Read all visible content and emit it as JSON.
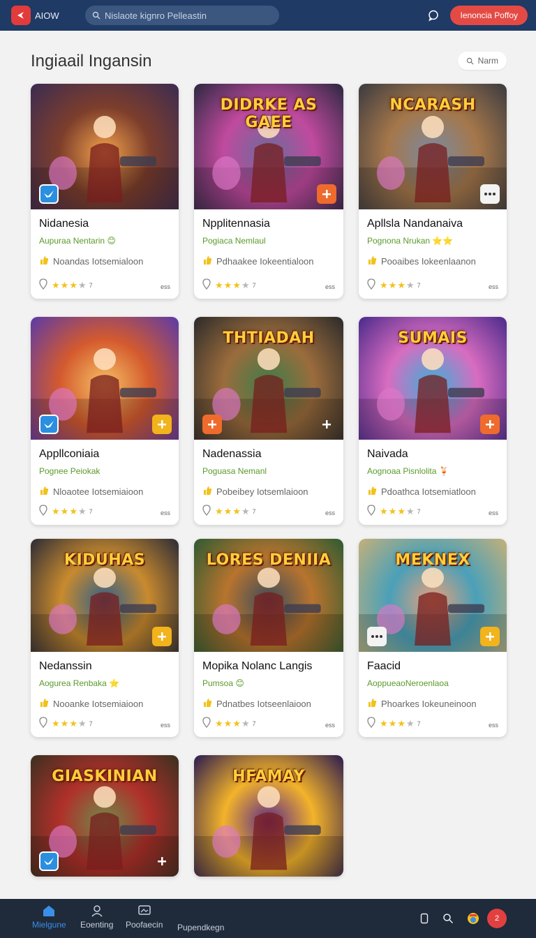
{
  "header": {
    "logo_text": "AIOW",
    "search_placeholder": "Nislaote kignro Pelleastin",
    "cta_label": "Ienoncia Poffoy"
  },
  "page": {
    "title": "Ingiaail Ingansin",
    "sort_label": "Narm"
  },
  "cards": [
    {
      "name": "Nidanesia",
      "sub": "Aupuraa Nentarin",
      "sub_emoji": "😊",
      "desc": "Noandas Iotsemialoon",
      "stars": 3,
      "rating_count": "7",
      "meta": "ess",
      "art_title": "",
      "colors": [
        "#f2a24a",
        "#7d3e2c",
        "#3b2b52"
      ],
      "badge_left": "blue",
      "badge_right": ""
    },
    {
      "name": "Npplitennasia",
      "sub": "Pogiaca Nemlaul",
      "sub_emoji": "",
      "desc": "Pdhaakee Iokeentialoon",
      "stars": 3,
      "rating_count": "7",
      "meta": "ess",
      "art_title": "DIDRKE AS GAEE",
      "colors": [
        "#6a6c9a",
        "#c04a9e",
        "#2b2840"
      ],
      "badge_left": "",
      "badge_right": "orange"
    },
    {
      "name": "Apllsla Nandanaiva",
      "sub": "Pognona Nrukan",
      "sub_emoji": "⭐⭐",
      "desc": "Pooaibes Iokeenlaanon",
      "stars": 3,
      "rating_count": "7",
      "meta": "ess",
      "art_title": "NCARASH",
      "colors": [
        "#7b8aa0",
        "#a5774a",
        "#3a3a40"
      ],
      "badge_left": "",
      "badge_right": "white"
    },
    {
      "name": "Appllconiaia",
      "sub": "Pognee Peiokak",
      "sub_emoji": "",
      "desc": "Nloaotee Iotsemiaioon",
      "stars": 3,
      "rating_count": "7",
      "meta": "ess",
      "art_title": "",
      "colors": [
        "#f5c064",
        "#d45a2e",
        "#5a3aa8"
      ],
      "badge_left": "blue",
      "badge_right": "yellow"
    },
    {
      "name": "Nadenassia",
      "sub": "Poguasa Nemanl",
      "sub_emoji": "",
      "desc": "Pobeibey Iotsemlaioon",
      "stars": 3,
      "rating_count": "7",
      "meta": "ess",
      "art_title": "THTIADAH",
      "colors": [
        "#3e7c4a",
        "#9b6c3c",
        "#2a2a2a"
      ],
      "badge_left": "orange",
      "badge_right": "clear"
    },
    {
      "name": "Naivada",
      "sub": "Aognoaa Pisnlolita",
      "sub_emoji": "🍹",
      "desc": "Pdoathca Iotsemiatloon",
      "stars": 3,
      "rating_count": "7",
      "meta": "ess",
      "art_title": "SUMAIS",
      "colors": [
        "#3ab0d8",
        "#d86cc0",
        "#4a2a8a"
      ],
      "badge_left": "",
      "badge_right": "orange"
    },
    {
      "name": "Nedanssin",
      "sub": "Aogurea Renbaka",
      "sub_emoji": "⭐",
      "desc": "Nooanke Iotsemiaioon",
      "stars": 3,
      "rating_count": "7",
      "meta": "ess",
      "art_title": "KIDUHAS",
      "colors": [
        "#2f5f8a",
        "#c98a2e",
        "#2b2b36"
      ],
      "badge_left": "",
      "badge_right": "yellow"
    },
    {
      "name": "Mopika Nolanc Langis",
      "sub": "Pumsoa",
      "sub_emoji": "😊",
      "desc": "Pdnatbes Iotseenlaioon",
      "stars": 3,
      "rating_count": "7",
      "meta": "ess",
      "art_title": "LORES DENIIA",
      "colors": [
        "#3b4b5c",
        "#b8742e",
        "#2d5a32"
      ],
      "badge_left": "",
      "badge_right": ""
    },
    {
      "name": "Faacid",
      "sub": "AoppueaoNeroenlaoa",
      "sub_emoji": "",
      "desc": "Phoarkes Iokeuneinoon",
      "stars": 3,
      "rating_count": "7",
      "meta": "ess",
      "art_title": "MEKNEX",
      "colors": [
        "#e8a07a",
        "#4aa0b8",
        "#c4b07a"
      ],
      "badge_left": "white",
      "badge_right": "yellow"
    },
    {
      "name": "",
      "sub": "",
      "sub_emoji": "",
      "desc": "",
      "stars": 0,
      "rating_count": "",
      "meta": "",
      "art_title": "GIASKINIAN",
      "colors": [
        "#6f8a4a",
        "#b0302a",
        "#3a3020"
      ],
      "badge_left": "blue",
      "badge_right": "clear"
    },
    {
      "name": "",
      "sub": "",
      "sub_emoji": "",
      "desc": "",
      "stars": 0,
      "rating_count": "",
      "meta": "",
      "art_title": "HFAMAY",
      "colors": [
        "#5a2a8a",
        "#f3b32a",
        "#2a1a50"
      ],
      "badge_left": "",
      "badge_right": ""
    }
  ],
  "bottom_nav": {
    "items": [
      {
        "label": "Mielgune",
        "icon": "home-icon"
      },
      {
        "label": "Eoenting",
        "icon": "user-icon"
      },
      {
        "label": "Poofaecin",
        "icon": "gallery-icon"
      },
      {
        "label": "Pupendkegn",
        "icon": ""
      }
    ],
    "notification_count": "2"
  },
  "colors": {
    "header_bg": "#1f3a64",
    "accent_red": "#e44a44",
    "subtitle_green": "#5a9a2a",
    "star_gold": "#f1c21b",
    "nav_active": "#3a8fe8"
  }
}
